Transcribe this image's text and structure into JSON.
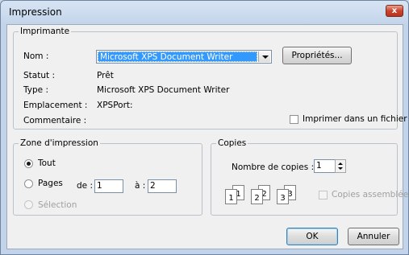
{
  "window": {
    "title": "Impression",
    "close_glyph": "x"
  },
  "printer_group": {
    "legend": "Imprimante",
    "name_label": "Nom :",
    "name_value": "Microsoft XPS Document Writer",
    "properties_button": "Propriétés...",
    "status_label": "Statut :",
    "status_value": "Prêt",
    "type_label": "Type :",
    "type_value": "Microsoft XPS Document Writer",
    "location_label": "Emplacement :",
    "location_value": "XPSPort:",
    "comment_label": "Commentaire :",
    "print_to_file_label": "Imprimer dans un fichier",
    "print_to_file_checked": false
  },
  "range_group": {
    "legend": "Zone d'impression",
    "all_label": "Tout",
    "all_selected": true,
    "pages_label": "Pages",
    "from_label": "de :",
    "from_value": "1",
    "to_label": "à :",
    "to_value": "2",
    "selection_label": "Sélection"
  },
  "copies_group": {
    "legend": "Copies",
    "count_label": "Nombre de copies :",
    "count_value": "1",
    "collate_label": "Copies assemblées",
    "collate_checked": false,
    "collate_pages": [
      {
        "back": "1",
        "front": "1"
      },
      {
        "back": "2",
        "front": "2"
      },
      {
        "back": "3",
        "front": "3"
      }
    ]
  },
  "buttons": {
    "ok": "OK",
    "cancel": "Annuler"
  }
}
